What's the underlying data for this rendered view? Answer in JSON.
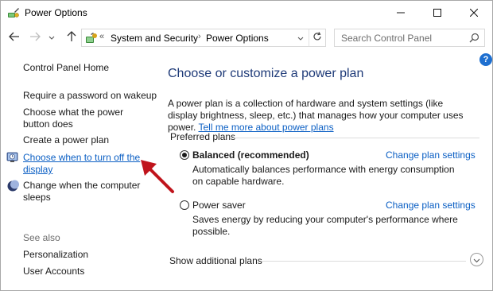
{
  "window": {
    "title": "Power Options"
  },
  "address_bar": {
    "overflow": "«",
    "path": [
      "System and Security",
      "Power Options"
    ],
    "separator": "›"
  },
  "search": {
    "placeholder": "Search Control Panel"
  },
  "left_pane": {
    "home": "Control Panel Home",
    "links": [
      "Require a password on wakeup",
      "Choose what the power button does",
      "Create a power plan",
      "Choose when to turn off the display",
      "Change when the computer sleeps"
    ],
    "active_link_index": 3,
    "see_also_heading": "See also",
    "see_also": [
      "Personalization",
      "User Accounts"
    ]
  },
  "main": {
    "help_label": "?",
    "title": "Choose or customize a power plan",
    "intro_text": "A power plan is a collection of hardware and system settings (like display brightness, sleep, etc.) that manages how your computer uses power.",
    "intro_link": "Tell me more about power plans",
    "preferred_plans_label": "Preferred plans",
    "plans": [
      {
        "name": "Balanced (recommended)",
        "selected": true,
        "change_label": "Change plan settings",
        "description": "Automatically balances performance with energy consumption on capable hardware."
      },
      {
        "name": "Power saver",
        "selected": false,
        "change_label": "Change plan settings",
        "description": "Saves energy by reducing your computer's performance where possible."
      }
    ],
    "show_additional": "Show additional plans"
  },
  "colors": {
    "link": "#0b5fc4",
    "title": "#1e3a78",
    "annotation_arrow": "#c0141c"
  },
  "icons": {
    "title": "power-options-icon",
    "back": "arrow-left-icon",
    "forward": "arrow-right-icon",
    "recent": "chevron-down-icon",
    "up": "arrow-up-icon",
    "refresh": "refresh-icon",
    "search": "search-icon",
    "display": "monitor-clock-icon",
    "sleep": "moon-icon",
    "help": "help-icon",
    "expand": "chevron-down-circle-icon"
  }
}
